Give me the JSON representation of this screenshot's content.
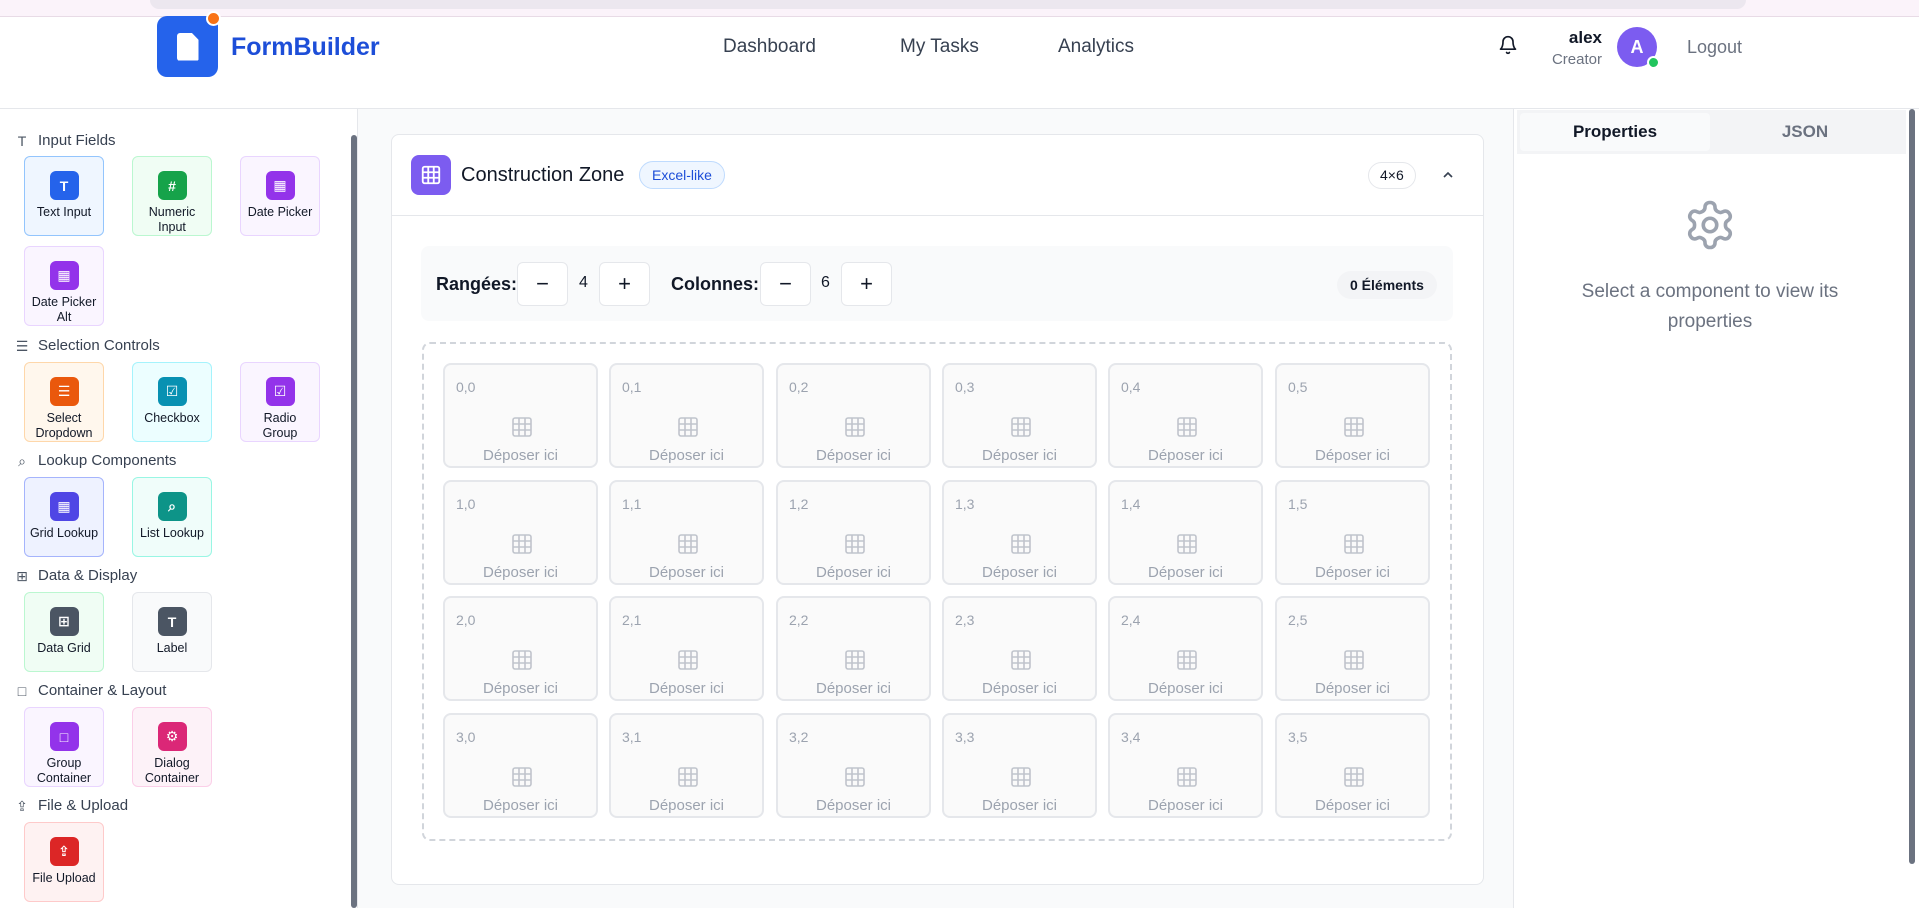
{
  "header": {
    "brand": "FormBuilder",
    "nav": [
      "Dashboard",
      "My Tasks",
      "Analytics"
    ],
    "user_name": "alex",
    "user_role": "Creator",
    "avatar_initial": "A",
    "logout": "Logout"
  },
  "sidebar": {
    "sections": [
      {
        "title": "Input Fields",
        "icon": "text-type-icon",
        "items": [
          {
            "label": "Text Input",
            "icon": "text-icon",
            "color": "#2563eb"
          },
          {
            "label": "Numeric Input",
            "icon": "hash-icon",
            "color": "#16a34a"
          },
          {
            "label": "Date Picker",
            "icon": "calendar-icon",
            "color": "#9333ea"
          },
          {
            "label": "Date Picker Alt",
            "icon": "calendar-icon",
            "color": "#9333ea"
          }
        ]
      },
      {
        "title": "Selection Controls",
        "icon": "list-icon",
        "items": [
          {
            "label": "Select Dropdown",
            "icon": "list-icon",
            "color": "#ea580c"
          },
          {
            "label": "Checkbox",
            "icon": "checkbox-icon",
            "color": "#0891b2"
          },
          {
            "label": "Radio Group",
            "icon": "radio-icon",
            "color": "#9333ea"
          }
        ]
      },
      {
        "title": "Lookup Components",
        "icon": "search-icon",
        "items": [
          {
            "label": "Grid Lookup",
            "icon": "grid-icon",
            "color": "#4f46e5"
          },
          {
            "label": "List Lookup",
            "icon": "search-icon",
            "color": "#0d9488"
          }
        ]
      },
      {
        "title": "Data & Display",
        "icon": "table-icon",
        "items": [
          {
            "label": "Data Grid",
            "icon": "table-icon",
            "color": "#4b5563"
          },
          {
            "label": "Label",
            "icon": "text-icon",
            "color": "#4b5563"
          }
        ]
      },
      {
        "title": "Container & Layout",
        "icon": "square-icon",
        "items": [
          {
            "label": "Group Container",
            "icon": "square-icon",
            "color": "#9333ea"
          },
          {
            "label": "Dialog Container",
            "icon": "gear-icon",
            "color": "#db2777"
          }
        ]
      },
      {
        "title": "File & Upload",
        "icon": "upload-icon",
        "items": [
          {
            "label": "File Upload",
            "icon": "upload-icon",
            "color": "#dc2626"
          }
        ]
      }
    ]
  },
  "zone": {
    "title": "Construction Zone",
    "badge": "Excel-like",
    "size": "4×6",
    "rows_label": "Rangées:",
    "rows": "4",
    "cols_label": "Colonnes:",
    "cols": "6",
    "minus": "−",
    "plus": "+",
    "elements": "0 Éléments",
    "drop_text": "Déposer ici",
    "cells": [
      [
        "0,0",
        "0,1",
        "0,2",
        "0,3",
        "0,4",
        "0,5"
      ],
      [
        "1,0",
        "1,1",
        "1,2",
        "1,3",
        "1,4",
        "1,5"
      ],
      [
        "2,0",
        "2,1",
        "2,2",
        "2,3",
        "2,4",
        "2,5"
      ],
      [
        "3,0",
        "3,1",
        "3,2",
        "3,3",
        "3,4",
        "3,5"
      ]
    ]
  },
  "panel": {
    "tabs": [
      "Properties",
      "JSON"
    ],
    "empty_message": "Select a component to view its properties"
  }
}
